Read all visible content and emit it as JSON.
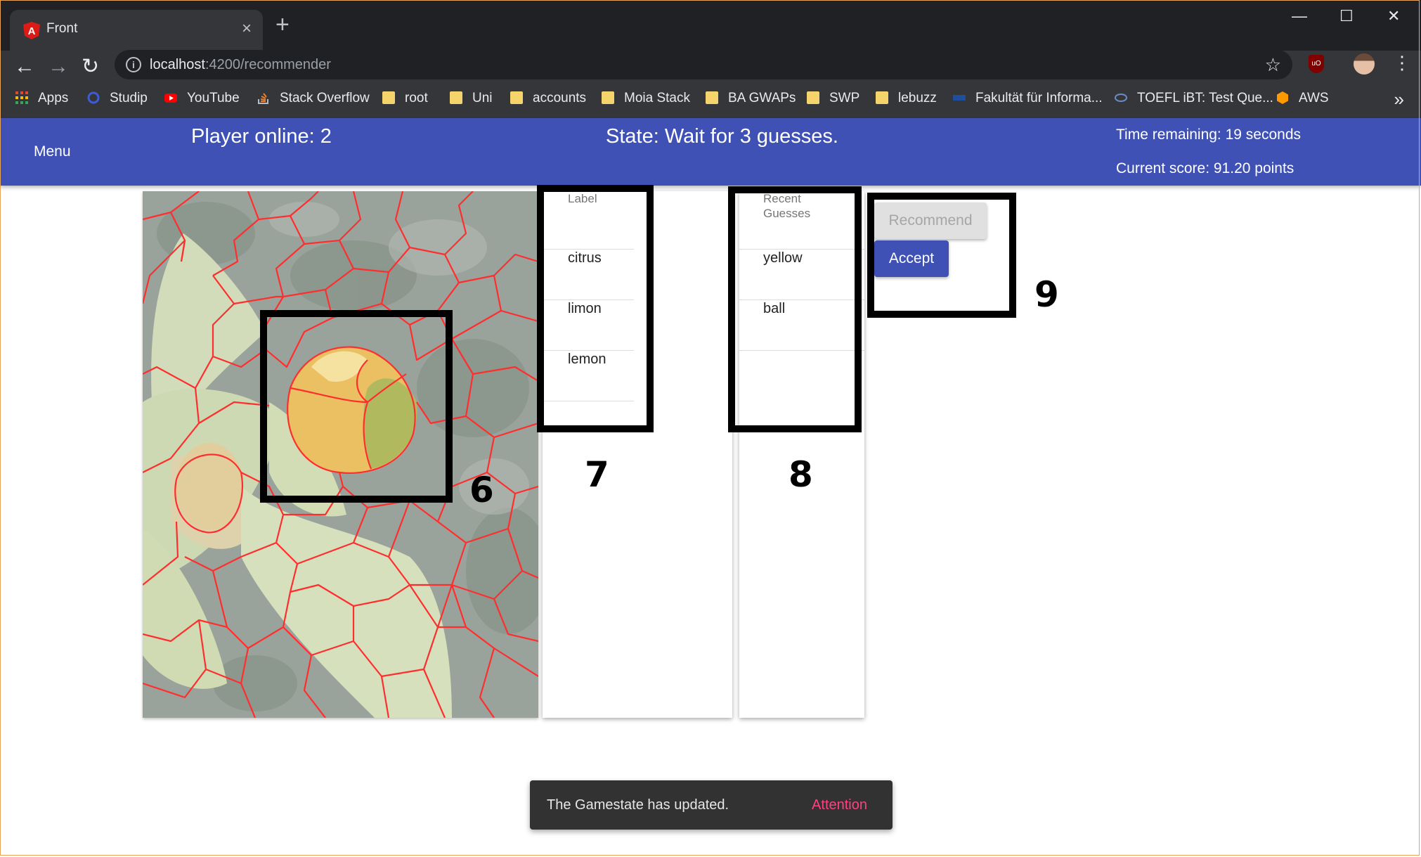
{
  "browser": {
    "tab_title": "Front",
    "tab_close": "×",
    "new_tab": "+",
    "window_controls": {
      "minimize": "—",
      "maximize": "☐",
      "close": "✕"
    },
    "nav": {
      "back": "←",
      "forward": "→",
      "reload": "↻"
    },
    "url_host": "localhost",
    "url_rest": ":4200/recommender",
    "bookmarks": [
      {
        "label": "Apps",
        "icon": "apps-grid-icon"
      },
      {
        "label": "Studip",
        "icon": "studip-icon"
      },
      {
        "label": "YouTube",
        "icon": "youtube-icon"
      },
      {
        "label": "Stack Overflow",
        "icon": "stackoverflow-icon"
      },
      {
        "label": "root",
        "icon": "folder-icon"
      },
      {
        "label": "Uni",
        "icon": "folder-icon"
      },
      {
        "label": "accounts",
        "icon": "folder-icon"
      },
      {
        "label": "Moia Stack",
        "icon": "folder-icon"
      },
      {
        "label": "BA GWAPs",
        "icon": "folder-icon"
      },
      {
        "label": "SWP",
        "icon": "folder-icon"
      },
      {
        "label": "lebuzz",
        "icon": "folder-icon"
      },
      {
        "label": "Fakultät für Informa...",
        "icon": "fakultaet-icon"
      },
      {
        "label": "TOEFL iBT: Test Que...",
        "icon": "toefl-icon"
      },
      {
        "label": "AWS",
        "icon": "aws-icon"
      }
    ],
    "bookmarks_more": "»"
  },
  "header": {
    "menu_label": "Menu",
    "players_online": "Player online: 2",
    "state": "State: Wait for 3 guesses.",
    "time_remaining": "Time remaining: 19 seconds",
    "current_score": "Current score: 91.20 points"
  },
  "labels_panel": {
    "header": "Label",
    "rows": [
      "citrus",
      "limon",
      "lemon"
    ]
  },
  "guesses_panel": {
    "header": "Recent Guesses",
    "rows": [
      "yellow",
      "ball",
      ""
    ]
  },
  "actions": {
    "recommend_label": "Recommend",
    "accept_label": "Accept"
  },
  "annotations": {
    "image": "6",
    "labels": "7",
    "guesses": "8",
    "actions": "9"
  },
  "snackbar": {
    "message": "The Gamestate has updated.",
    "action": "Attention"
  },
  "colors": {
    "appbar": "#3f51b5",
    "accept_button": "#3f51b5",
    "snackbar_action": "#ff4081",
    "segment_outline": "#ff0000"
  }
}
